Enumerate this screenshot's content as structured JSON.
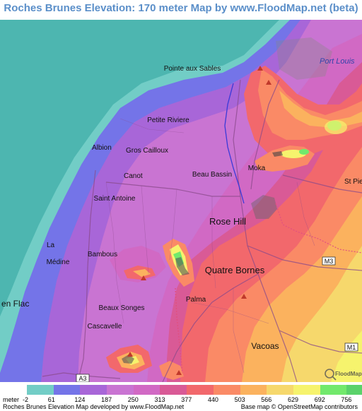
{
  "title": "Roches Brunes Elevation: 170 meter Map by www.FloodMap.net (beta)",
  "places": {
    "pointe_aux_sables": "Pointe aux Sables",
    "port_louis": "Port Louis",
    "petite_riviere": "Petite Riviere",
    "albion": "Albion",
    "gros_cailloux": "Gros Cailloux",
    "canot": "Canot",
    "beau_bassin": "Beau Bassin",
    "moka": "Moka",
    "st_pie": "St Pie",
    "saint_antoine": "Saint Antoine",
    "rose_hill": "Rose Hill",
    "la": "La",
    "bambous": "Bambous",
    "medine": "Médine",
    "quatre_bornes": "Quatre Bornes",
    "en_flac": "en Flac",
    "palma": "Palma",
    "beaux_songes": "Beaux Songes",
    "cascavelle": "Cascavelle",
    "vacoas": "Vacoas"
  },
  "roads": {
    "m3": "M3",
    "m1": "M1",
    "a3": "A3"
  },
  "watermark": "FloodMap",
  "legend": {
    "unit_label": "meter",
    "items": [
      {
        "value": "-2",
        "color": "#72cdc6"
      },
      {
        "value": "61",
        "color": "#7474e8"
      },
      {
        "value": "124",
        "color": "#a866d8"
      },
      {
        "value": "187",
        "color": "#c974d2"
      },
      {
        "value": "250",
        "color": "#d169c4"
      },
      {
        "value": "313",
        "color": "#d95a96"
      },
      {
        "value": "377",
        "color": "#f2686c"
      },
      {
        "value": "440",
        "color": "#fa8a66"
      },
      {
        "value": "503",
        "color": "#fbb25e"
      },
      {
        "value": "566",
        "color": "#f6d86c"
      },
      {
        "value": "629",
        "color": "#f6f36d"
      },
      {
        "value": "692",
        "color": "#72e96c"
      },
      {
        "value": "756",
        "color": "#5ad26a"
      }
    ]
  },
  "footer": {
    "left": "Roches Brunes Elevation Map developed by www.FloodMap.net",
    "right": "Base map © OpenStreetMap contributors"
  }
}
